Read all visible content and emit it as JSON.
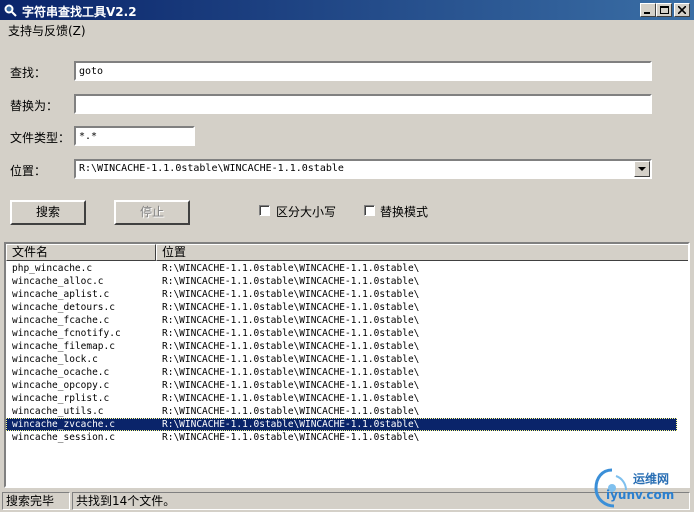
{
  "window": {
    "title": "字符串查找工具V2.2"
  },
  "menu": {
    "items": [
      "支持与反馈(Z)"
    ]
  },
  "form": {
    "find_label": "查找：",
    "find_value": "goto",
    "replace_label": "替换为：",
    "replace_value": "",
    "filetype_label": "文件类型：",
    "filetype_value": "*.*",
    "location_label": "位置：",
    "location_value": "R:\\WINCACHE-1.1.0stable\\WINCACHE-1.1.0stable"
  },
  "buttons": {
    "search": "搜索",
    "stop": "停止"
  },
  "options": {
    "case_label": "区分大小写",
    "case_checked": false,
    "replace_mode_label": "替换模式",
    "replace_mode_checked": false
  },
  "results": {
    "columns": [
      "文件名",
      "位置"
    ],
    "rows": [
      [
        "php_wincache.c",
        "R:\\WINCACHE-1.1.0stable\\WINCACHE-1.1.0stable\\"
      ],
      [
        "wincache_alloc.c",
        "R:\\WINCACHE-1.1.0stable\\WINCACHE-1.1.0stable\\"
      ],
      [
        "wincache_aplist.c",
        "R:\\WINCACHE-1.1.0stable\\WINCACHE-1.1.0stable\\"
      ],
      [
        "wincache_detours.c",
        "R:\\WINCACHE-1.1.0stable\\WINCACHE-1.1.0stable\\"
      ],
      [
        "wincache_fcache.c",
        "R:\\WINCACHE-1.1.0stable\\WINCACHE-1.1.0stable\\"
      ],
      [
        "wincache_fcnotify.c",
        "R:\\WINCACHE-1.1.0stable\\WINCACHE-1.1.0stable\\"
      ],
      [
        "wincache_filemap.c",
        "R:\\WINCACHE-1.1.0stable\\WINCACHE-1.1.0stable\\"
      ],
      [
        "wincache_lock.c",
        "R:\\WINCACHE-1.1.0stable\\WINCACHE-1.1.0stable\\"
      ],
      [
        "wincache_ocache.c",
        "R:\\WINCACHE-1.1.0stable\\WINCACHE-1.1.0stable\\"
      ],
      [
        "wincache_opcopy.c",
        "R:\\WINCACHE-1.1.0stable\\WINCACHE-1.1.0stable\\"
      ],
      [
        "wincache_rplist.c",
        "R:\\WINCACHE-1.1.0stable\\WINCACHE-1.1.0stable\\"
      ],
      [
        "wincache_utils.c",
        "R:\\WINCACHE-1.1.0stable\\WINCACHE-1.1.0stable\\"
      ],
      [
        "wincache_zvcache.c",
        "R:\\WINCACHE-1.1.0stable\\WINCACHE-1.1.0stable\\"
      ],
      [
        "wincache_session.c",
        "R:\\WINCACHE-1.1.0stable\\WINCACHE-1.1.0stable\\"
      ]
    ],
    "selected_index": 12
  },
  "status": {
    "state": "搜索完毕",
    "message": "共找到14个文件。"
  },
  "watermark": {
    "name": "运维网",
    "url": "iyunv.com"
  },
  "colors": {
    "titlebar": "#0a246a",
    "selection": "#0a246a",
    "face": "#d4d0c8"
  }
}
